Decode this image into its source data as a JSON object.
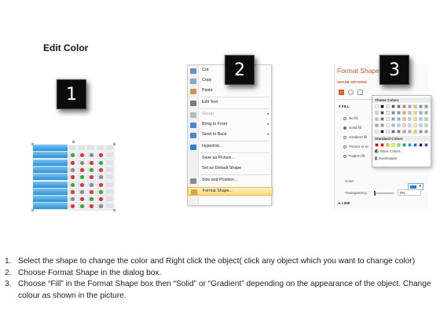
{
  "title": "Edit Color",
  "badges": [
    "1",
    "2",
    "3"
  ],
  "context_menu": {
    "items": [
      {
        "label": "Cut",
        "icon": "scissors-icon",
        "color": "#6a8fb8",
        "dim": false,
        "arrow": false
      },
      {
        "label": "Copy",
        "icon": "copy-icon",
        "color": "#8aa4c6",
        "dim": false,
        "arrow": false
      },
      {
        "label": "Paste",
        "icon": "paste-icon",
        "color": "#c49a4a",
        "dim": false,
        "arrow": false
      },
      {
        "label": "Edit Text",
        "icon": "edit-text-icon",
        "color": "#7a7a7a",
        "dim": false,
        "arrow": false
      },
      {
        "label": "Group",
        "icon": "group-icon",
        "color": "#b9b9b9",
        "dim": true,
        "arrow": true
      },
      {
        "label": "Bring to Front",
        "icon": "bring-to-front-icon",
        "color": "#4f86c6",
        "dim": false,
        "arrow": true
      },
      {
        "label": "Send to Back",
        "icon": "send-to-back-icon",
        "color": "#4f86c6",
        "dim": false,
        "arrow": true
      },
      {
        "label": "Hyperlink...",
        "icon": "hyperlink-icon",
        "color": "#3b7dc4",
        "dim": false,
        "arrow": false
      },
      {
        "label": "Save as Picture...",
        "icon": "",
        "color": "",
        "dim": false,
        "arrow": false
      },
      {
        "label": "Set as Default Shape",
        "icon": "",
        "color": "",
        "dim": false,
        "arrow": false
      },
      {
        "label": "Size and Position...",
        "icon": "size-position-icon",
        "color": "#8a8a8a",
        "dim": false,
        "arrow": false
      },
      {
        "label": "Format Shape...",
        "icon": "format-shape-icon",
        "color": "#d8a63b",
        "dim": false,
        "arrow": false
      }
    ],
    "highlighted": "Format Shape..."
  },
  "format_pane": {
    "title": "Format Shape",
    "shape_options": "SHAPE OPTIONS",
    "fill_section": "FILL",
    "fill_options": [
      "No fill",
      "Solid fill",
      "Gradient fill",
      "Picture or texture fill",
      "Pattern fill"
    ],
    "fill_labels_shown": [
      "No fill",
      "Solid fill",
      "Gradient fill",
      "Picture or te",
      "Pattern fill"
    ],
    "selected_fill": "Solid fill",
    "color_label": "Color",
    "transparency_label": "Transparency",
    "transparency_value": "0%",
    "line_section": "LINE",
    "accent_color": "#c55a3a"
  },
  "palette": {
    "theme_header": "Theme Colors",
    "standard_header": "Standard Colors",
    "more_colors": "More Colors...",
    "eyedropper": "Eyedropper",
    "theme_top": [
      "#ffffff",
      "#000000",
      "#e7e6e6",
      "#44546a",
      "#4472c4",
      "#ed7d31",
      "#a5a5a5",
      "#ffc000",
      "#5b9bd5",
      "#70ad47"
    ],
    "standard": [
      "#c00000",
      "#ff0000",
      "#ffc000",
      "#ffff00",
      "#92d050",
      "#00b050",
      "#00b0f0",
      "#0070c0",
      "#002060",
      "#7030a0"
    ]
  },
  "steps": [
    {
      "num": "1.",
      "text": "Select the shape to change the color and Right click the object( click any object which you want to change color)"
    },
    {
      "num": "2.",
      "text": "Choose Format Shape in the dialog box."
    },
    {
      "num": "3.",
      "text": "Choose “Fill” in the Format Shape box then “Solid” or “Gradient” depending on the appearance of the object. Change colour as shown in the picture."
    }
  ]
}
